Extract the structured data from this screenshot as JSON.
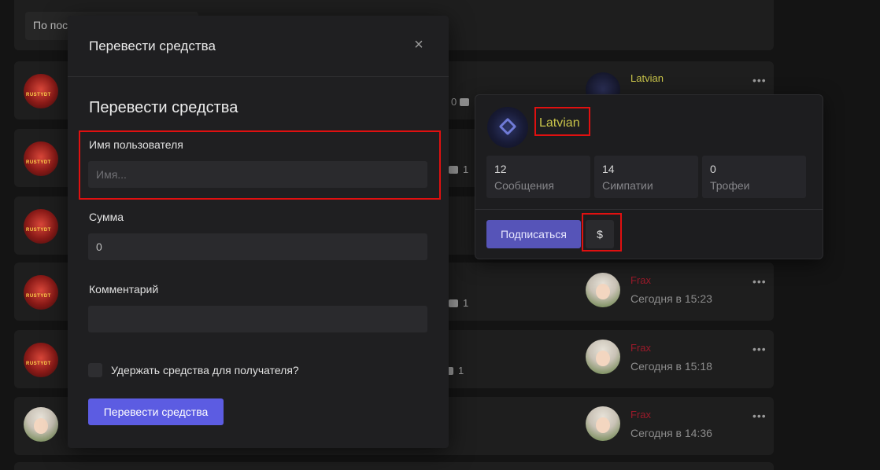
{
  "filter": {
    "placeholder_text": "По последним"
  },
  "threads": [
    {
      "replies": "0",
      "last_user": "Latvian",
      "last_time": "",
      "last_user_color": "#c9c44a"
    },
    {
      "replies": "1",
      "last_user": "",
      "last_time": ""
    },
    {
      "replies": "",
      "last_user": "",
      "last_time": ""
    },
    {
      "replies": "1",
      "last_user": "Frax",
      "last_time": "Сегодня в 15:23",
      "last_user_color": "#9b1a2a"
    },
    {
      "replies": "1",
      "last_user": "Frax",
      "last_time": "Сегодня в 15:18",
      "last_user_color": "#9b1a2a"
    },
    {
      "replies": "",
      "last_user": "Frax",
      "last_time": "Сегодня в 14:36",
      "last_user_color": "#9b1a2a"
    }
  ],
  "modal": {
    "header_title": "Перевести средства",
    "section_title": "Перевести средства",
    "username_label": "Имя пользователя",
    "username_placeholder": "Имя...",
    "amount_label": "Сумма",
    "amount_value": "0",
    "comment_label": "Комментарий",
    "comment_value": "",
    "hold_label": "Удержать средства для получателя?",
    "submit_label": "Перевести средства",
    "close_glyph": "×"
  },
  "popup": {
    "username": "Latvian",
    "stats": [
      {
        "value": "12",
        "label": "Сообщения"
      },
      {
        "value": "14",
        "label": "Симпатии"
      },
      {
        "value": "0",
        "label": "Трофеи"
      }
    ],
    "follow_label": "Подписаться",
    "dollar_label": "$"
  },
  "colors": {
    "accent": "#5c5ce2",
    "highlight": "#e01010",
    "username_gold": "#c9c44a"
  },
  "icons": [
    "close-icon",
    "comment-icon",
    "more-dots-icon"
  ]
}
